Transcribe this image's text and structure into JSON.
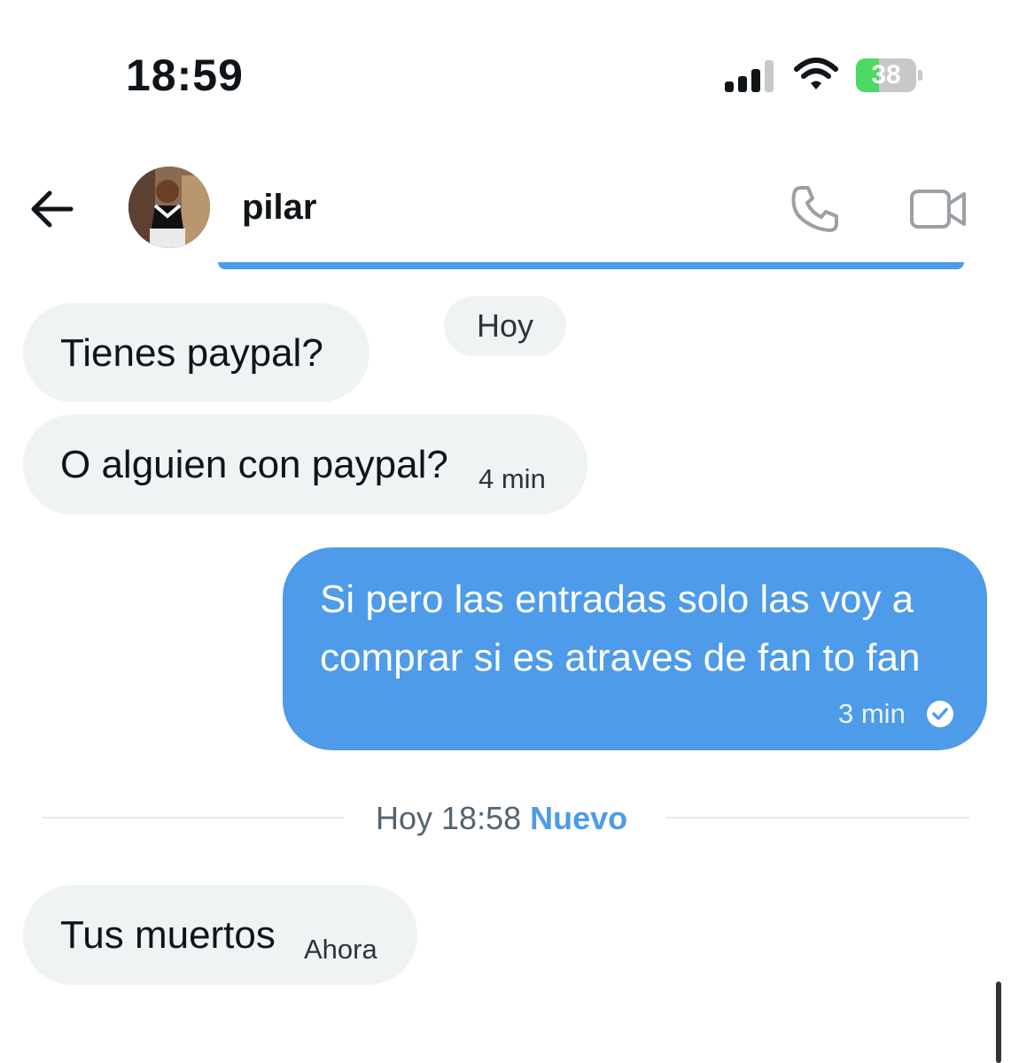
{
  "status_bar": {
    "time": "18:59",
    "battery": "38",
    "battery_level": 0.38
  },
  "header": {
    "contact_name": "pilar"
  },
  "date_chip": "Hoy",
  "messages": [
    {
      "text": "Tienes paypal?",
      "time": ""
    },
    {
      "text": "O alguien con paypal?",
      "time": "4 min"
    },
    {
      "line1": "Si pero las entradas solo las voy a",
      "line2": "comprar si es atraves de fan to fan",
      "time": "3 min"
    },
    {
      "text": "Tus muertos",
      "time": "Ahora"
    }
  ],
  "divider": {
    "time": "Hoy 18:58",
    "new_label": "Nuevo"
  },
  "colors": {
    "accent": "#4d9be9",
    "incoming_bubble": "#eff3f4"
  }
}
